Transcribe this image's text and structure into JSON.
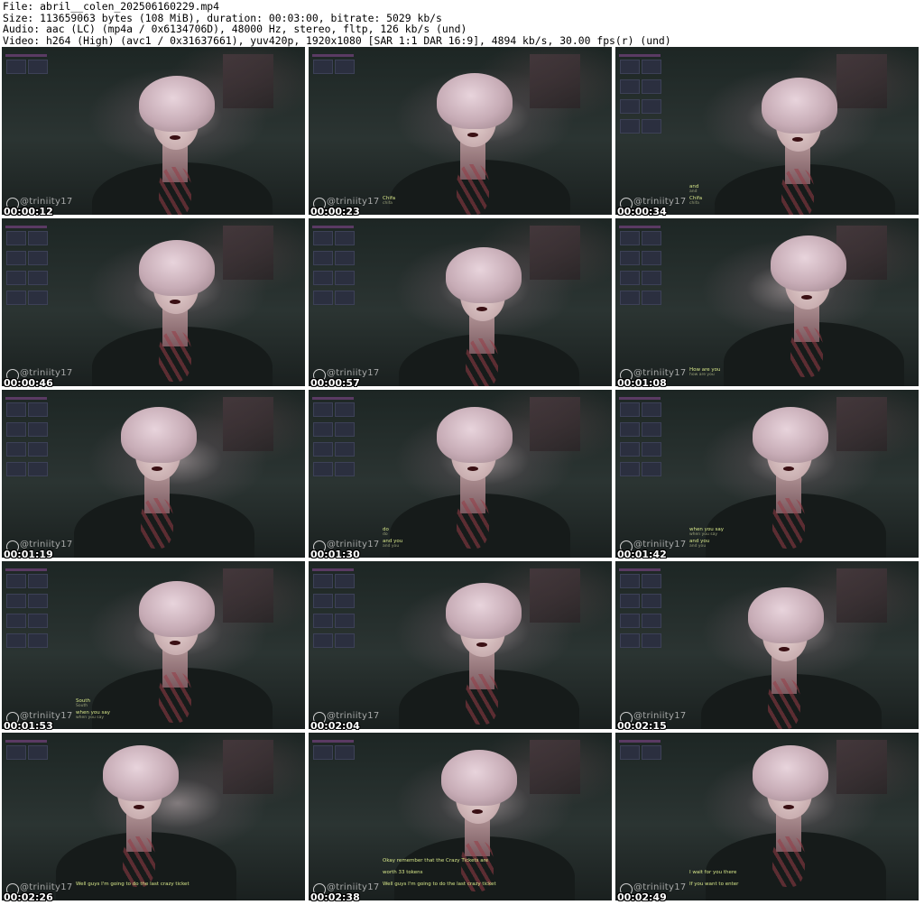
{
  "header": {
    "file": "File: abril__colen_202506160229.mp4",
    "size": "Size: 113659063 bytes (108 MiB), duration: 00:03:00, bitrate: 5029 kb/s",
    "audio": "Audio: aac (LC) (mp4a / 0x6134706D), 48000 Hz, stereo, fltp, 126 kb/s (und)",
    "video": "Video: h264 (High) (avc1 / 0x31637661), yuv420p, 1920x1080 [SAR 1:1 DAR 16:9], 4894 kb/s, 30.00 fps(r) (und)"
  },
  "watermark": "@triniity17",
  "thumbnails": [
    {
      "timestamp": "00:00:12",
      "captions": []
    },
    {
      "timestamp": "00:00:23",
      "captions": [
        {
          "main": "Chifa",
          "sub": "chifa"
        }
      ]
    },
    {
      "timestamp": "00:00:34",
      "captions": [
        {
          "main": "and",
          "sub": "and"
        },
        {
          "main": "Chifa",
          "sub": "chifa"
        }
      ]
    },
    {
      "timestamp": "00:00:46",
      "captions": []
    },
    {
      "timestamp": "00:00:57",
      "captions": []
    },
    {
      "timestamp": "00:01:08",
      "captions": [
        {
          "main": "How are you",
          "sub": "how are you"
        }
      ]
    },
    {
      "timestamp": "00:01:19",
      "captions": []
    },
    {
      "timestamp": "00:01:30",
      "captions": [
        {
          "main": "do",
          "sub": "do"
        },
        {
          "main": "and you",
          "sub": "and you"
        }
      ]
    },
    {
      "timestamp": "00:01:42",
      "captions": [
        {
          "main": "when you say",
          "sub": "when you say"
        },
        {
          "main": "and you",
          "sub": "and you"
        }
      ]
    },
    {
      "timestamp": "00:01:53",
      "captions": [
        {
          "main": "South",
          "sub": "South"
        },
        {
          "main": "when you say",
          "sub": "when you say"
        }
      ]
    },
    {
      "timestamp": "00:02:04",
      "captions": []
    },
    {
      "timestamp": "00:02:15",
      "captions": []
    },
    {
      "timestamp": "00:02:26",
      "captions": [
        {
          "main": "Well guys I'm going to do the last crazy ticket",
          "sub": ""
        }
      ]
    },
    {
      "timestamp": "00:02:38",
      "captions": [
        {
          "main": "Okay remember that the Crazy Tickets are",
          "sub": ""
        },
        {
          "main": "worth 33 tokens",
          "sub": ""
        },
        {
          "main": "Well guys I'm going to do the last crazy ticket",
          "sub": ""
        }
      ]
    },
    {
      "timestamp": "00:02:49",
      "captions": [
        {
          "main": "I wait for you there",
          "sub": ""
        },
        {
          "main": "If you want to enter",
          "sub": ""
        }
      ]
    }
  ]
}
